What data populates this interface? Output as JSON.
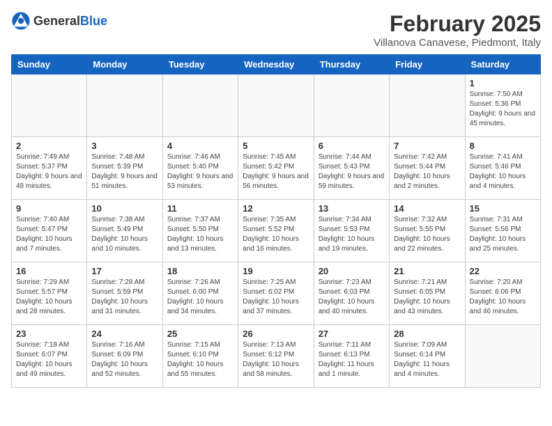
{
  "header": {
    "logo_general": "General",
    "logo_blue": "Blue",
    "month_year": "February 2025",
    "location": "Villanova Canavese, Piedmont, Italy"
  },
  "weekdays": [
    "Sunday",
    "Monday",
    "Tuesday",
    "Wednesday",
    "Thursday",
    "Friday",
    "Saturday"
  ],
  "weeks": [
    [
      {
        "day": "",
        "detail": ""
      },
      {
        "day": "",
        "detail": ""
      },
      {
        "day": "",
        "detail": ""
      },
      {
        "day": "",
        "detail": ""
      },
      {
        "day": "",
        "detail": ""
      },
      {
        "day": "",
        "detail": ""
      },
      {
        "day": "1",
        "detail": "Sunrise: 7:50 AM\nSunset: 5:36 PM\nDaylight: 9 hours and 45 minutes."
      }
    ],
    [
      {
        "day": "2",
        "detail": "Sunrise: 7:49 AM\nSunset: 5:37 PM\nDaylight: 9 hours and 48 minutes."
      },
      {
        "day": "3",
        "detail": "Sunrise: 7:48 AM\nSunset: 5:39 PM\nDaylight: 9 hours and 51 minutes."
      },
      {
        "day": "4",
        "detail": "Sunrise: 7:46 AM\nSunset: 5:40 PM\nDaylight: 9 hours and 53 minutes."
      },
      {
        "day": "5",
        "detail": "Sunrise: 7:45 AM\nSunset: 5:42 PM\nDaylight: 9 hours and 56 minutes."
      },
      {
        "day": "6",
        "detail": "Sunrise: 7:44 AM\nSunset: 5:43 PM\nDaylight: 9 hours and 59 minutes."
      },
      {
        "day": "7",
        "detail": "Sunrise: 7:42 AM\nSunset: 5:44 PM\nDaylight: 10 hours and 2 minutes."
      },
      {
        "day": "8",
        "detail": "Sunrise: 7:41 AM\nSunset: 5:46 PM\nDaylight: 10 hours and 4 minutes."
      }
    ],
    [
      {
        "day": "9",
        "detail": "Sunrise: 7:40 AM\nSunset: 5:47 PM\nDaylight: 10 hours and 7 minutes."
      },
      {
        "day": "10",
        "detail": "Sunrise: 7:38 AM\nSunset: 5:49 PM\nDaylight: 10 hours and 10 minutes."
      },
      {
        "day": "11",
        "detail": "Sunrise: 7:37 AM\nSunset: 5:50 PM\nDaylight: 10 hours and 13 minutes."
      },
      {
        "day": "12",
        "detail": "Sunrise: 7:35 AM\nSunset: 5:52 PM\nDaylight: 10 hours and 16 minutes."
      },
      {
        "day": "13",
        "detail": "Sunrise: 7:34 AM\nSunset: 5:53 PM\nDaylight: 10 hours and 19 minutes."
      },
      {
        "day": "14",
        "detail": "Sunrise: 7:32 AM\nSunset: 5:55 PM\nDaylight: 10 hours and 22 minutes."
      },
      {
        "day": "15",
        "detail": "Sunrise: 7:31 AM\nSunset: 5:56 PM\nDaylight: 10 hours and 25 minutes."
      }
    ],
    [
      {
        "day": "16",
        "detail": "Sunrise: 7:29 AM\nSunset: 5:57 PM\nDaylight: 10 hours and 28 minutes."
      },
      {
        "day": "17",
        "detail": "Sunrise: 7:28 AM\nSunset: 5:59 PM\nDaylight: 10 hours and 31 minutes."
      },
      {
        "day": "18",
        "detail": "Sunrise: 7:26 AM\nSunset: 6:00 PM\nDaylight: 10 hours and 34 minutes."
      },
      {
        "day": "19",
        "detail": "Sunrise: 7:25 AM\nSunset: 6:02 PM\nDaylight: 10 hours and 37 minutes."
      },
      {
        "day": "20",
        "detail": "Sunrise: 7:23 AM\nSunset: 6:03 PM\nDaylight: 10 hours and 40 minutes."
      },
      {
        "day": "21",
        "detail": "Sunrise: 7:21 AM\nSunset: 6:05 PM\nDaylight: 10 hours and 43 minutes."
      },
      {
        "day": "22",
        "detail": "Sunrise: 7:20 AM\nSunset: 6:06 PM\nDaylight: 10 hours and 46 minutes."
      }
    ],
    [
      {
        "day": "23",
        "detail": "Sunrise: 7:18 AM\nSunset: 6:07 PM\nDaylight: 10 hours and 49 minutes."
      },
      {
        "day": "24",
        "detail": "Sunrise: 7:16 AM\nSunset: 6:09 PM\nDaylight: 10 hours and 52 minutes."
      },
      {
        "day": "25",
        "detail": "Sunrise: 7:15 AM\nSunset: 6:10 PM\nDaylight: 10 hours and 55 minutes."
      },
      {
        "day": "26",
        "detail": "Sunrise: 7:13 AM\nSunset: 6:12 PM\nDaylight: 10 hours and 58 minutes."
      },
      {
        "day": "27",
        "detail": "Sunrise: 7:11 AM\nSunset: 6:13 PM\nDaylight: 11 hours and 1 minute."
      },
      {
        "day": "28",
        "detail": "Sunrise: 7:09 AM\nSunset: 6:14 PM\nDaylight: 11 hours and 4 minutes."
      },
      {
        "day": "",
        "detail": ""
      }
    ]
  ]
}
